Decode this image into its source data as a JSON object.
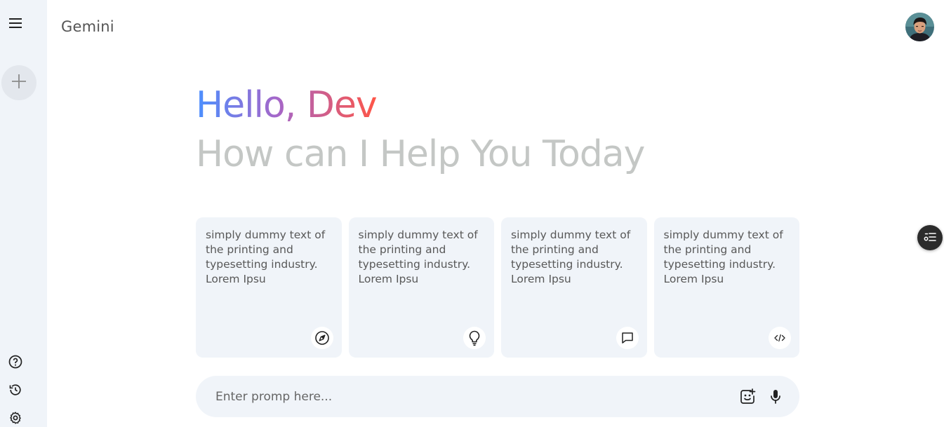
{
  "app": {
    "title": "Gemini"
  },
  "sidebar": {
    "top": [
      {
        "icon": "menu-icon"
      },
      {
        "icon": "plus-icon"
      }
    ],
    "bottom": [
      {
        "icon": "help-icon"
      },
      {
        "icon": "history-icon"
      },
      {
        "icon": "settings-icon"
      }
    ]
  },
  "greeting": {
    "hello": "Hello, Dev",
    "subtitle": "How can I Help You Today"
  },
  "cards": [
    {
      "text": "simply dummy text of the printing and typesetting industry. Lorem Ipsu",
      "icon": "compass-icon"
    },
    {
      "text": "simply dummy text of the printing and typesetting industry. Lorem Ipsu",
      "icon": "lightbulb-icon"
    },
    {
      "text": "simply dummy text of the printing and typesetting industry. Lorem Ipsu",
      "icon": "message-icon"
    },
    {
      "text": "simply dummy text of the printing and typesetting industry. Lorem Ipsu",
      "icon": "code-icon"
    }
  ],
  "prompt": {
    "placeholder": "Enter promp here...",
    "value": ""
  },
  "colors": {
    "sidebar_bg": "#f0f4f9",
    "gradient_start": "#4b90ff",
    "gradient_end": "#ff5546",
    "subtitle": "#c4c7c5"
  }
}
